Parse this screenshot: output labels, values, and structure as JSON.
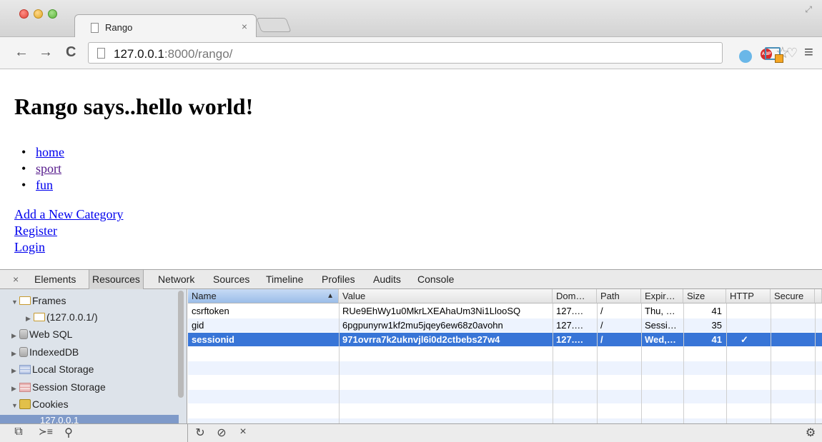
{
  "browser": {
    "tab_title": "Rango",
    "tab_close": "×",
    "url_host": "127.0.0.1",
    "url_rest": ":8000/rango/",
    "abp_label": "ABP",
    "back": "←",
    "forward": "→",
    "reload": "C",
    "star": "☆",
    "menu": "≡",
    "fullscreen": "⤢"
  },
  "page": {
    "heading": "Rango says..hello world!",
    "categories": [
      "home",
      "sport",
      "fun"
    ],
    "links": [
      "Add a New Category",
      "Register",
      "Login"
    ]
  },
  "devtools": {
    "close": "×",
    "tabs": [
      "Elements",
      "Resources",
      "Network",
      "Sources",
      "Timeline",
      "Profiles",
      "Audits",
      "Console"
    ],
    "active_tab": "Resources",
    "tree": {
      "frames": "Frames",
      "frame_child": "(127.0.0.1/)",
      "web_sql": "Web SQL",
      "indexed_db": "IndexedDB",
      "local_storage": "Local Storage",
      "session_storage": "Session Storage",
      "cookies": "Cookies",
      "cookie_host": "127.0.0.1"
    },
    "columns": [
      "Name",
      "Value",
      "Dom…",
      "Path",
      "Expir…",
      "Size",
      "HTTP",
      "Secure"
    ],
    "rows": [
      {
        "name": "csrftoken",
        "value": "RUe9EhWy1u0MkrLXEAhaUm3Ni1LlooSQ",
        "domain": "127.…",
        "path": "/",
        "expires": "Thu, …",
        "size": "41",
        "http": "",
        "secure": ""
      },
      {
        "name": "gid",
        "value": "6pgpunyrw1kf2mu5jqey6ew68z0avohn",
        "domain": "127.…",
        "path": "/",
        "expires": "Sessi…",
        "size": "35",
        "http": "",
        "secure": ""
      },
      {
        "name": "sessionid",
        "value": "971ovrra7k2uknvjl6i0d2ctbebs27w4",
        "domain": "127.…",
        "path": "/",
        "expires": "Wed,…",
        "size": "41",
        "http": "✓",
        "secure": ""
      }
    ],
    "selected_row": 2,
    "sort_indicator": "▲",
    "status_icons": {
      "dock": "⧉",
      "console": "≻≡",
      "search": "⚲",
      "refresh": "↻",
      "clear": "⊘",
      "delete": "×",
      "settings": "⚙"
    }
  }
}
